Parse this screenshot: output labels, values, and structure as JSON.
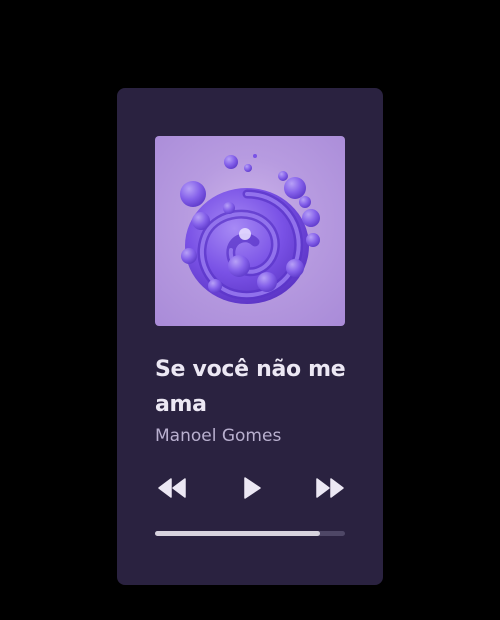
{
  "player": {
    "title": "Se você não me ama",
    "artist": "Manoel Gomes",
    "progress": 0.87,
    "colors": {
      "background": "#000000",
      "card": "#2a2240",
      "title": "#ece8f4",
      "artist": "#b9b0cf",
      "progress_fill": "#d7d3de",
      "progress_track": "#4e4766",
      "cover_bg": "#b79be0",
      "cover_art": "#7b4fe0"
    },
    "controls": {
      "previous_icon": "rewind-icon",
      "play_icon": "play-icon",
      "next_icon": "fast-forward-icon"
    },
    "cover_icon": "album-art-purple-swirl"
  }
}
